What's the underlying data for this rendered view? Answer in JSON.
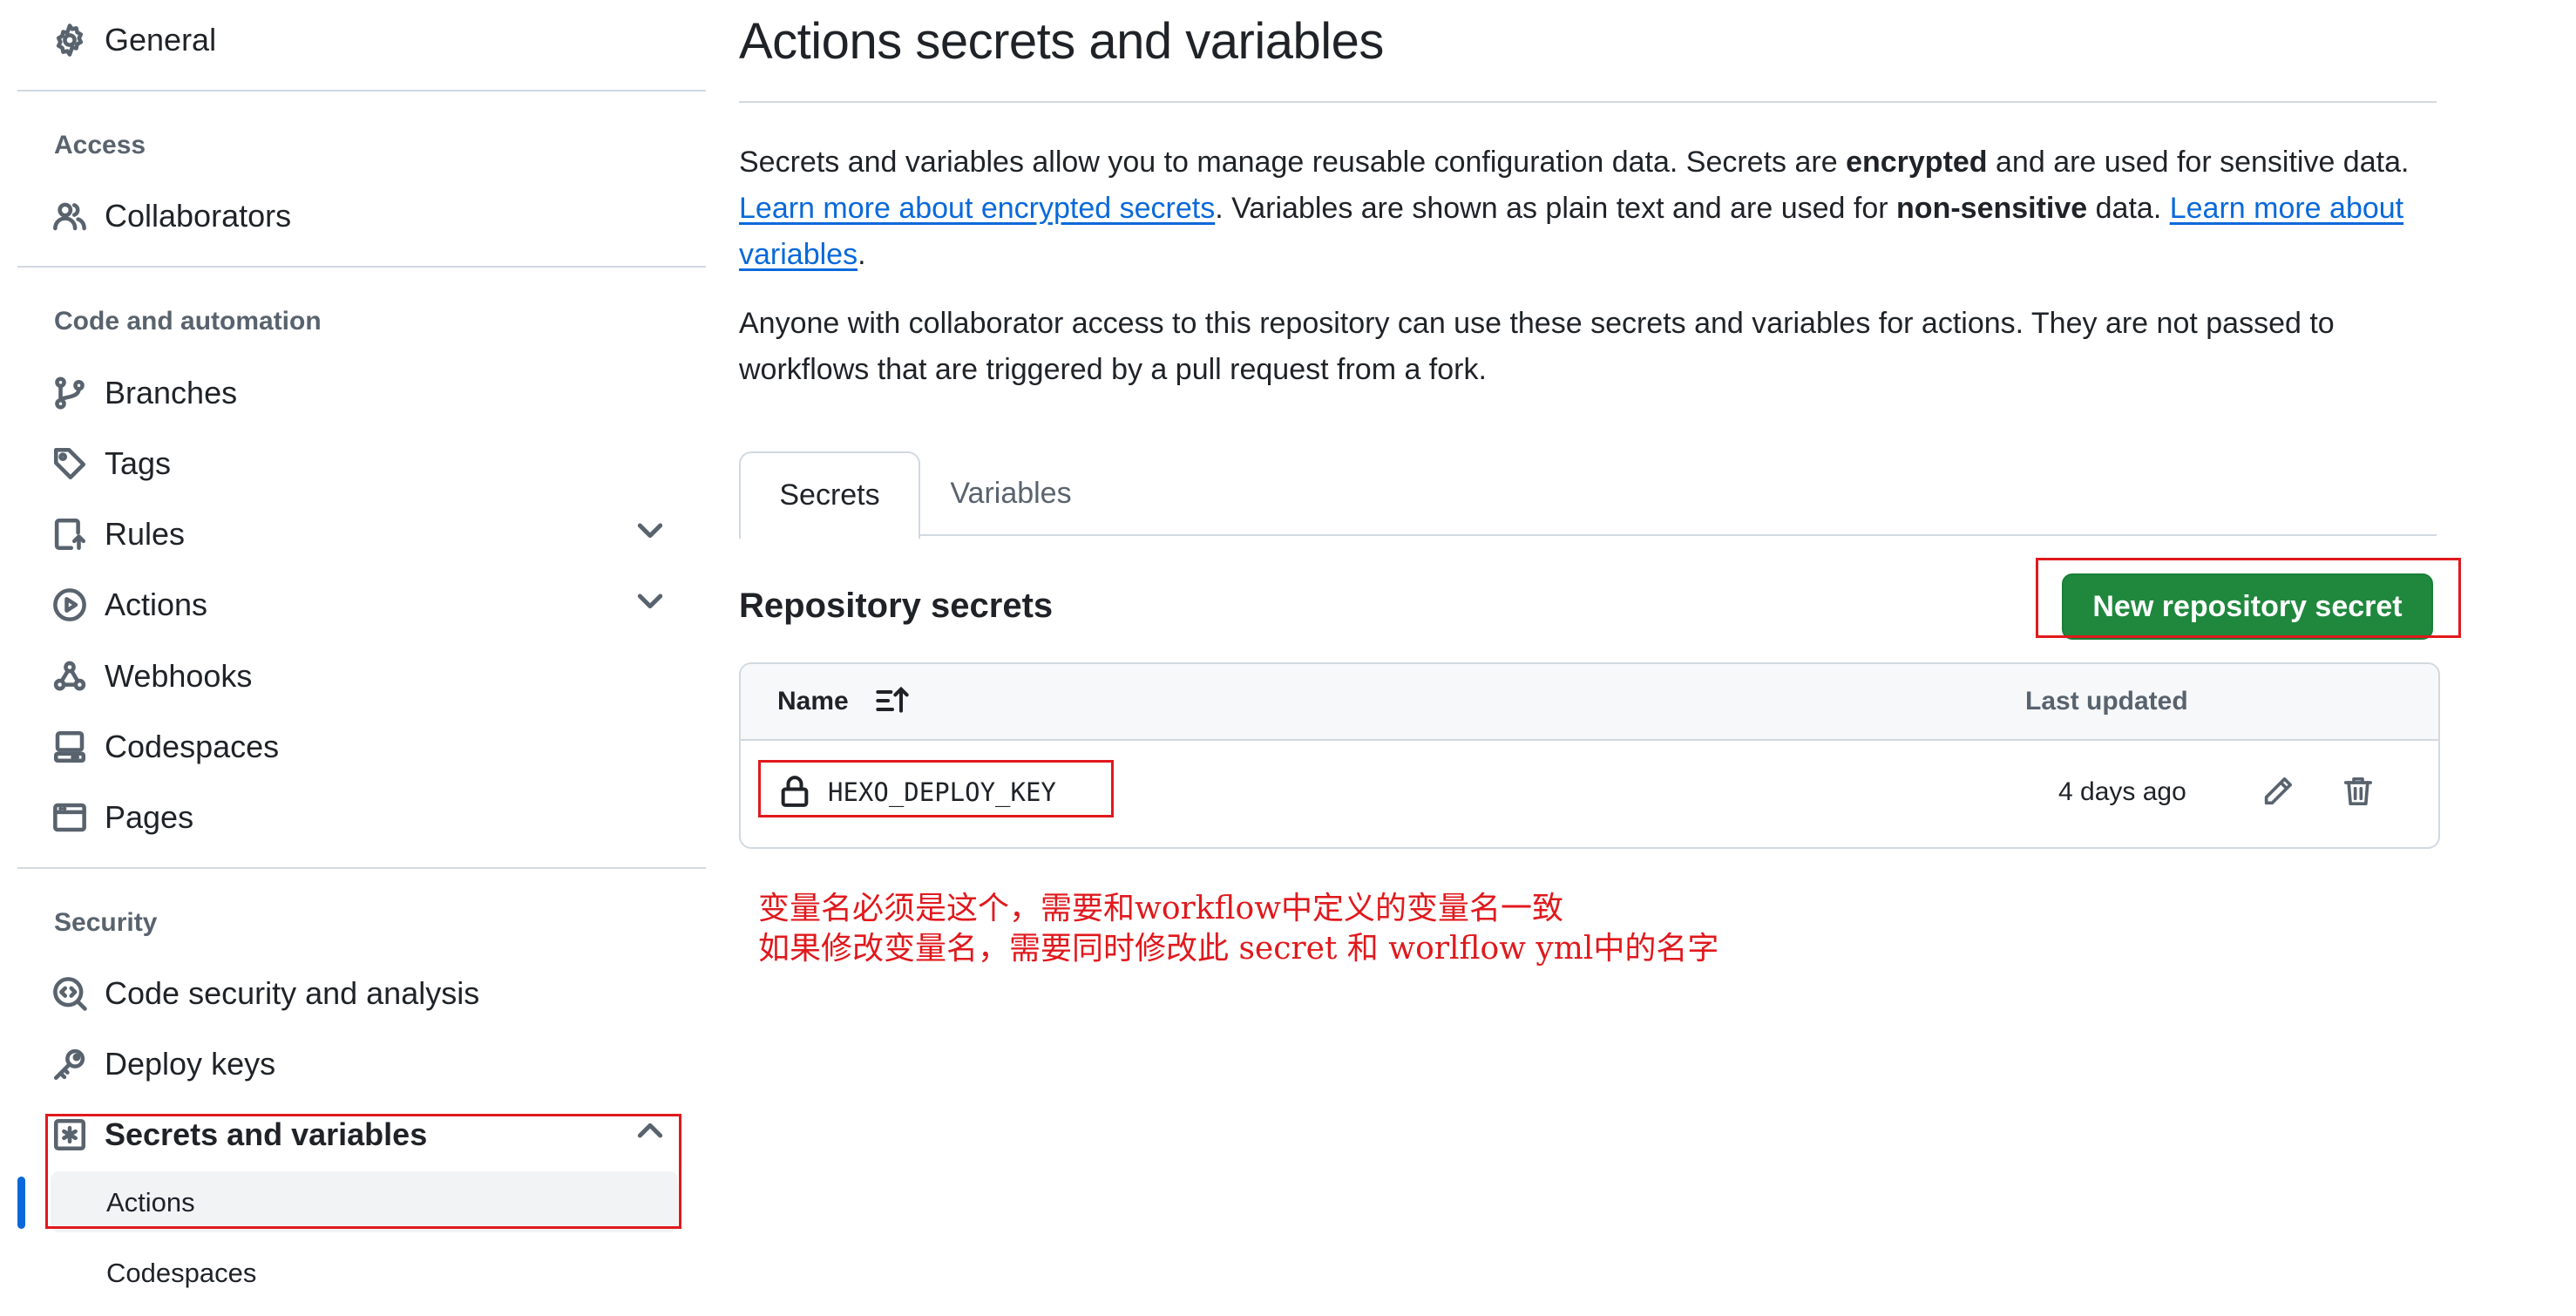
{
  "sidebar": {
    "general": "General",
    "access_heading": "Access",
    "collaborators": "Collaborators",
    "code_heading": "Code and automation",
    "branches": "Branches",
    "tags": "Tags",
    "rules": "Rules",
    "actions": "Actions",
    "webhooks": "Webhooks",
    "codespaces": "Codespaces",
    "pages": "Pages",
    "security_heading": "Security",
    "code_security": "Code security and analysis",
    "deploy_keys": "Deploy keys",
    "secrets_and_variables": "Secrets and variables",
    "sub_actions": "Actions",
    "sub_codespaces": "Codespaces"
  },
  "main": {
    "title": "Actions secrets and variables",
    "intro": {
      "p1_a": "Secrets and variables allow you to manage reusable configuration data. Secrets are ",
      "p1_b": "encrypted",
      "p1_c": " and are used for sensitive data. ",
      "p1_link1": "Learn more about encrypted secrets",
      "p1_d": ". Variables are shown as plain text and are used for ",
      "p1_e": "non-sensitive",
      "p1_f": " data. ",
      "p1_link2": "Learn more about variables",
      "p1_g": ".",
      "p2": "Anyone with collaborator access to this repository can use these secrets and variables for actions. They are not passed to workflows that are triggered by a pull request from a fork."
    },
    "tabs": {
      "secrets": "Secrets",
      "variables": "Variables"
    },
    "repo_secrets_heading": "Repository secrets",
    "new_secret_button": "New repository secret",
    "table": {
      "col_name": "Name",
      "col_updated": "Last updated",
      "rows": [
        {
          "name": "HEXO_DEPLOY_KEY",
          "updated": "4 days ago"
        }
      ]
    }
  },
  "annotation": {
    "line1": "变量名必须是这个，需要和workflow中定义的变量名一致",
    "line2": "如果修改变量名，需要同时修改此 secret 和 worlflow yml中的名字"
  },
  "colors": {
    "accent_blue": "#0969da",
    "primary_green": "#1f883d",
    "annotation_red": "#e0191d"
  }
}
